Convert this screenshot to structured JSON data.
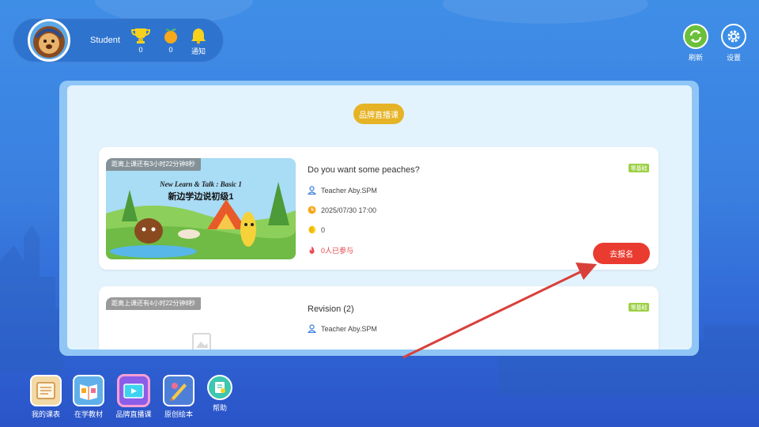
{
  "user": {
    "name": "Student"
  },
  "stats": [
    {
      "icon": "trophy-icon",
      "value": "0"
    },
    {
      "icon": "orange-icon",
      "value": "0"
    },
    {
      "icon": "bell-icon",
      "label": "通知"
    }
  ],
  "top_actions": {
    "refresh_label": "刷新",
    "settings_label": "设置"
  },
  "section": {
    "title": "品牌直播课"
  },
  "courses": [
    {
      "countdown": "距离上课还有3小时22分钟8秒",
      "title": "Do you want some peaches?",
      "teacher": "Teacher Aby.SPM",
      "time": "2025/07/30 17:00",
      "coins": "0",
      "participants": "0人已参与",
      "tag": "零基础",
      "action": "去报名",
      "thumb_title_en": "New Learn & Talk : Basic 1",
      "thumb_title_cn": "新边学边说初级1"
    },
    {
      "countdown": "距离上课还有4小时22分钟8秒",
      "title": "Revision (2)",
      "teacher": "Teacher Aby.SPM",
      "tag": "零基础"
    }
  ],
  "bottom_nav": [
    {
      "label": "我的课表",
      "icon": "schedule-icon"
    },
    {
      "label": "在学教材",
      "icon": "textbook-icon"
    },
    {
      "label": "品牌直播课",
      "icon": "live-class-icon"
    },
    {
      "label": "原创绘本",
      "icon": "picture-book-icon"
    },
    {
      "label": "帮助",
      "icon": "help-icon"
    }
  ],
  "colors": {
    "accent": "#e6b326",
    "signup": "#ea3b30",
    "tag": "#9cd046",
    "arrow": "#d9403a"
  }
}
